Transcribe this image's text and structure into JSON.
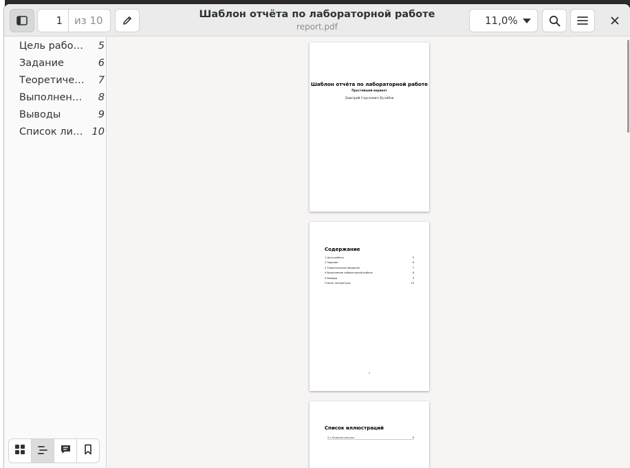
{
  "window": {
    "title": "Шаблон отчёта по лабораторной работе",
    "subtitle": "report.pdf"
  },
  "toolbar": {
    "current_page": "1",
    "total_pages": "из 10",
    "zoom": "11,0%"
  },
  "outline": [
    {
      "label": "Цель работы",
      "page": "5"
    },
    {
      "label": "Задание",
      "page": "6"
    },
    {
      "label": "Теоретическое введение",
      "page": "7"
    },
    {
      "label": "Выполнение лабораторной работы",
      "page": "8"
    },
    {
      "label": "Выводы",
      "page": "9"
    },
    {
      "label": "Список литературы",
      "page": "10"
    }
  ],
  "pages": {
    "title_page": {
      "title": "Шаблон отчёта по лабораторной работе",
      "subtitle": "Простейший вариант",
      "author": "Дмитрий Сергеевич Кулябов"
    },
    "contents_page": {
      "heading": "Содержание",
      "entries": [
        {
          "label": "1   Цель работы",
          "page": "5"
        },
        {
          "label": "2   Задание",
          "page": "6"
        },
        {
          "label": "3   Теоретическое введение",
          "page": "7"
        },
        {
          "label": "4   Выполнение лабораторной работы",
          "page": "8"
        },
        {
          "label": "5   Выводы",
          "page": "9"
        },
        {
          "label": "Список литературы",
          "page": "10"
        }
      ],
      "footer_number": "2"
    },
    "illustrations_page": {
      "heading": "Список иллюстраций",
      "entries": [
        {
          "label": "4.1   Название рисунка",
          "page": "8"
        }
      ]
    }
  }
}
